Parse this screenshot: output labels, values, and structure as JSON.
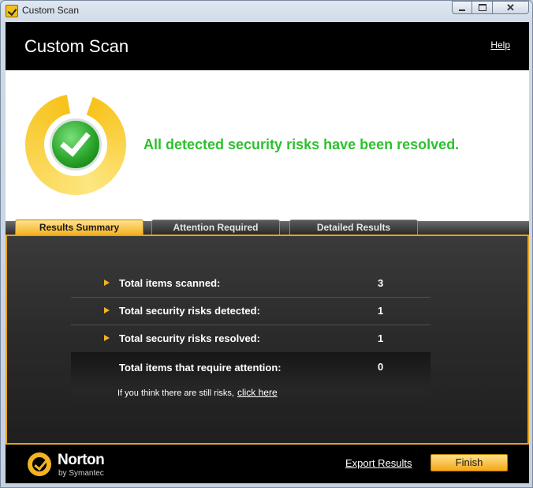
{
  "window": {
    "title": "Custom Scan"
  },
  "header": {
    "title": "Custom Scan",
    "help_label": "Help"
  },
  "status": {
    "message": "All detected security risks have been resolved.",
    "icon": "green-check-icon"
  },
  "tabs": [
    {
      "label": "Results Summary",
      "active": true
    },
    {
      "label": "Attention Required",
      "active": false
    },
    {
      "label": "Detailed Results",
      "active": false
    }
  ],
  "summary": {
    "rows": [
      {
        "label": "Total items scanned:",
        "value": "3"
      },
      {
        "label": "Total security risks detected:",
        "value": "1"
      },
      {
        "label": "Total security risks resolved:",
        "value": "1"
      }
    ],
    "attention": {
      "label": "Total items that require attention:",
      "value": "0"
    },
    "risk_note": "If you think there are still risks,",
    "click_here_label": "click here"
  },
  "footer": {
    "brand_name": "Norton",
    "brand_sub": "by Symantec",
    "export_label": "Export Results",
    "finish_label": "Finish"
  },
  "colors": {
    "accent": "#f4b320",
    "success_text": "#2ec12e",
    "panel_border": "#e7a31b"
  }
}
